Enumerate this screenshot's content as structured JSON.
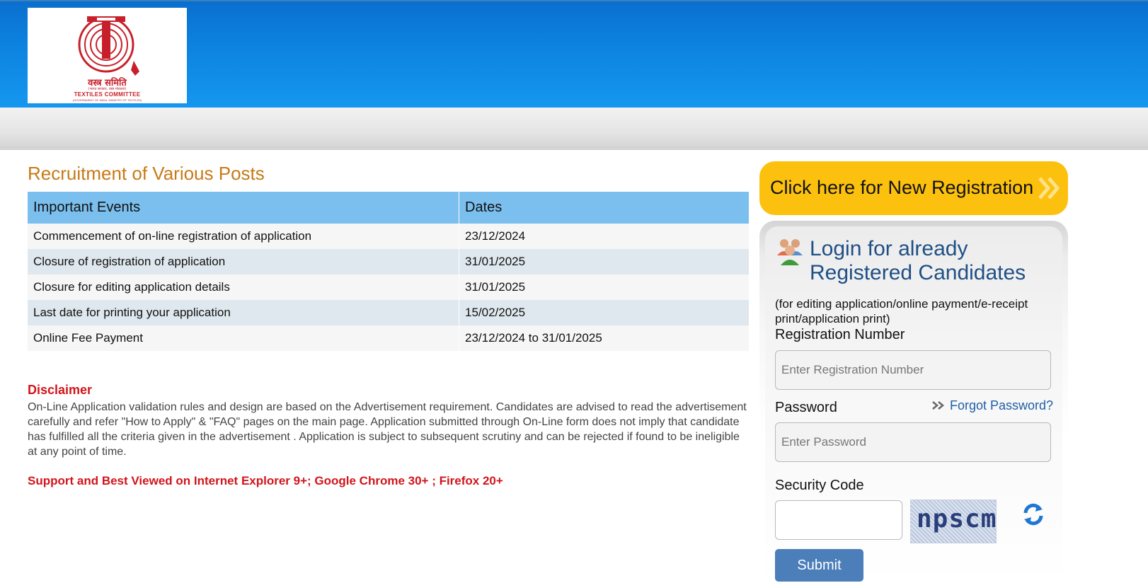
{
  "header": {
    "logo": {
      "hindi_name": "वस्त्र समिति",
      "hindi_subtitle": "(भारत सरकार, वस्त्र मंत्रालय)",
      "org_name": "TEXTILES COMMITTEE",
      "org_subtitle": "(GOVERNMENT OF INDIA, MINISTRY OF TEXTILES)"
    }
  },
  "main": {
    "title": "Recruitment of Various Posts",
    "table": {
      "headers": [
        "Important Events",
        "Dates"
      ],
      "rows": [
        {
          "event": "Commencement of on-line registration of application",
          "date": "23/12/2024"
        },
        {
          "event": "Closure of registration of application",
          "date": "31/01/2025"
        },
        {
          "event": "Closure for editing application details",
          "date": "31/01/2025"
        },
        {
          "event": "Last date for printing your application",
          "date": "15/02/2025"
        },
        {
          "event": "Online Fee Payment",
          "date": "23/12/2024 to 31/01/2025"
        }
      ]
    },
    "disclaimer": {
      "title": "Disclaimer",
      "text": "On-Line Application validation rules and design are based on the Advertisement requirement. Candidates are advised to read the advertisement carefully and refer \"How to Apply\" & \"FAQ\" pages on the main page. Application submitted through On-Line form does not imply that candidate has fulfilled all the criteria given in the advertisement . Application is subject to subsequent scrutiny and can be rejected if found to be ineligible at any point of time."
    },
    "support_text": "Support and Best Viewed on Internet Explorer 9+; Google Chrome 30+ ; Firefox 20+"
  },
  "sidebar": {
    "registration_button": "Click here for New Registration",
    "login": {
      "title": "Login for already Registered Candidates",
      "description": "(for editing application/online payment/e-receipt print/application print)",
      "registration_label": "Registration Number",
      "registration_placeholder": "Enter Registration Number",
      "password_label": "Password",
      "password_placeholder": "Enter Password",
      "forgot_password": "Forgot Password?",
      "security_label": "Security Code",
      "security_value": "",
      "captcha_text": "npscm",
      "submit_label": "Submit"
    }
  },
  "colors": {
    "header_blue": "#0d84e0",
    "title_orange": "#c77a16",
    "table_header": "#7bbfee",
    "disclaimer_red": "#d2141b",
    "register_yellow": "#fcc10f",
    "submit_blue": "#4c7fba",
    "login_title_blue": "#1f4f86"
  },
  "icons": [
    "textiles-committee-logo",
    "double-chevron-right-icon",
    "users-icon",
    "refresh-icon"
  ]
}
